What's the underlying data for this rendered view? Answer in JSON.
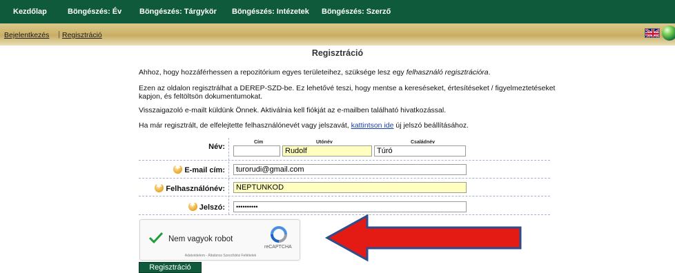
{
  "nav": {
    "items": [
      "Kezdőlap",
      "Böngészés: Év",
      "Böngészés: Tárgykör",
      "Böngészés: Intézetek",
      "Böngészés: Szerző"
    ]
  },
  "subnav": {
    "login": "Bejelentkezés",
    "register": "Regisztráció"
  },
  "page": {
    "title": "Regisztráció",
    "p1_a": "Ahhoz, hogy hozzáférhessen a repozitórium egyes területeihez, szüksége lesz egy ",
    "p1_em": "felhasználó regisztrációra",
    "p1_b": ".",
    "p2": "Ezen az oldalon regisztrálhat a DEREP-SZD-be. Ez lehetővé teszi, hogy mentse a kereséseket, értesítéseket / figyelmeztetéseket kapjon, és feltöltsön dokumentumokat.",
    "p3": "Visszaigazoló e-mailt küldünk Önnek. Aktiválnia kell fiókját az e-mailben található hivatkozással.",
    "p4_a": "Ha már regisztrált, de elfelejtette felhasználónevét vagy jelszavát, ",
    "p4_link": "kattintson ide",
    "p4_b": " új jelszó beállításához."
  },
  "form": {
    "name_label": "Név:",
    "title_sub": "Cím",
    "given_sub": "Utónév",
    "family_sub": "Családnév",
    "title_value": "",
    "given_value": "Rudolf",
    "family_value": "Túró",
    "email_label": "E-mail cím:",
    "email_value": "turorudi@gmail.com",
    "username_label": "Felhasználónév:",
    "username_value": "NEPTUNKOD",
    "password_label": "Jelszó:",
    "password_value": "••••••••••",
    "submit_label": "Regisztráció"
  },
  "captcha": {
    "label": "Nem vagyok robot",
    "brand": "reCAPTCHA",
    "terms": "Adatvédelem - Általános Szerződési Feltételek"
  },
  "colors": {
    "nav_bg": "#0e5a3a",
    "arrow_fill": "#e41b14",
    "arrow_stroke": "#2d4e8a",
    "required_field_bg": "#ffffc0"
  }
}
